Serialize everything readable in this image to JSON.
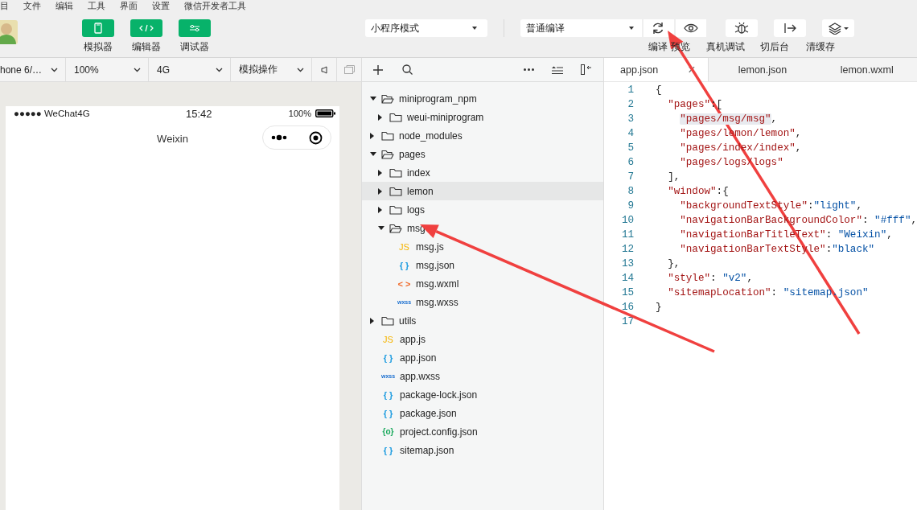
{
  "menu_bar": [
    "目",
    "文件",
    "编辑",
    "工具",
    "界面",
    "设置",
    "微信开发者工具"
  ],
  "toolbar": {
    "view_buttons": [
      {
        "label": "模拟器",
        "kind": "phone"
      },
      {
        "label": "编辑器",
        "kind": "code"
      },
      {
        "label": "调试器",
        "kind": "sliders"
      }
    ],
    "mode_select": "小程序模式",
    "compile_select": "普通编译",
    "actions": [
      {
        "label": "编译",
        "kind": "refresh"
      },
      {
        "label": "预览",
        "kind": "eye"
      },
      {
        "label": "真机调试",
        "kind": "bug"
      },
      {
        "label": "切后台",
        "kind": "switch"
      },
      {
        "label": "清缓存",
        "kind": "layers"
      }
    ]
  },
  "simulator": {
    "selects": [
      "hone 6/…",
      "100%",
      "4G",
      "模拟操作"
    ],
    "phone": {
      "carrier": "●●●●● WeChat4G",
      "time": "15:42",
      "battery": "100%",
      "title": "Weixin"
    }
  },
  "file_tree": [
    {
      "name": "miniprogram_npm",
      "kind": "folder",
      "expanded": true,
      "selected": false,
      "children": [
        {
          "name": "weui-miniprogram",
          "kind": "folder",
          "expanded": false,
          "selected": false
        }
      ]
    },
    {
      "name": "node_modules",
      "kind": "folder",
      "expanded": false,
      "selected": false
    },
    {
      "name": "pages",
      "kind": "folder",
      "expanded": true,
      "selected": false,
      "children": [
        {
          "name": "index",
          "kind": "folder",
          "expanded": false,
          "selected": false
        },
        {
          "name": "lemon",
          "kind": "folder",
          "expanded": false,
          "selected": true
        },
        {
          "name": "logs",
          "kind": "folder",
          "expanded": false,
          "selected": false
        },
        {
          "name": "msg",
          "kind": "folder",
          "expanded": true,
          "selected": false,
          "children": [
            {
              "name": "msg.js",
              "kind": "js",
              "badge": "JS",
              "selected": false
            },
            {
              "name": "msg.json",
              "kind": "json",
              "badge": "{ }",
              "selected": false
            },
            {
              "name": "msg.wxml",
              "kind": "wxml",
              "badge": "< >",
              "selected": false
            },
            {
              "name": "msg.wxss",
              "kind": "wxss",
              "badge": "wxss",
              "selected": false
            }
          ]
        }
      ]
    },
    {
      "name": "utils",
      "kind": "folder",
      "expanded": false,
      "selected": false
    },
    {
      "name": "app.js",
      "kind": "js",
      "badge": "JS",
      "selected": false
    },
    {
      "name": "app.json",
      "kind": "json",
      "badge": "{ }",
      "selected": false
    },
    {
      "name": "app.wxss",
      "kind": "wxss",
      "badge": "wxss",
      "selected": false
    },
    {
      "name": "package-lock.json",
      "kind": "json",
      "badge": "{ }",
      "selected": false
    },
    {
      "name": "package.json",
      "kind": "json",
      "badge": "{ }",
      "selected": false
    },
    {
      "name": "project.config.json",
      "kind": "config",
      "badge": "{o}",
      "selected": false
    },
    {
      "name": "sitemap.json",
      "kind": "json",
      "badge": "{ }",
      "selected": false
    }
  ],
  "editor": {
    "tabs": [
      {
        "label": "app.json",
        "selected": true,
        "close": "×"
      },
      {
        "label": "lemon.json",
        "selected": false
      },
      {
        "label": "lemon.wxml",
        "selected": false
      }
    ],
    "lines": [
      {
        "number": "1",
        "tokens": [
          {
            "kind": "punct",
            "text": "{"
          }
        ]
      },
      {
        "number": "2",
        "tokens": [
          {
            "kind": "key",
            "text": "  \"pages\""
          },
          {
            "kind": "punct",
            "text": ":["
          }
        ]
      },
      {
        "number": "3",
        "tokens": [
          {
            "kind": "key",
            "text": "    \"pages/msg/msg\"",
            "highlighted": true
          },
          {
            "kind": "punct",
            "text": ","
          }
        ]
      },
      {
        "number": "4",
        "tokens": [
          {
            "kind": "key",
            "text": "    \"pages/lemon/lemon\""
          },
          {
            "kind": "punct",
            "text": ","
          }
        ]
      },
      {
        "number": "5",
        "tokens": [
          {
            "kind": "key",
            "text": "    \"pages/index/index\""
          },
          {
            "kind": "punct",
            "text": ","
          }
        ]
      },
      {
        "number": "6",
        "tokens": [
          {
            "kind": "key",
            "text": "    \"pages/logs/logs\""
          }
        ]
      },
      {
        "number": "7",
        "tokens": [
          {
            "kind": "punct",
            "text": "  ],"
          }
        ]
      },
      {
        "number": "8",
        "tokens": [
          {
            "kind": "key",
            "text": "  \"window\""
          },
          {
            "kind": "punct",
            "text": ":{"
          }
        ]
      },
      {
        "number": "9",
        "tokens": [
          {
            "kind": "key",
            "text": "    \"backgroundTextStyle\""
          },
          {
            "kind": "punct",
            "text": ":"
          },
          {
            "kind": "value",
            "text": "\"light\""
          },
          {
            "kind": "punct",
            "text": ","
          }
        ]
      },
      {
        "number": "10",
        "tokens": [
          {
            "kind": "key",
            "text": "    \"navigationBarBackgroundColor\""
          },
          {
            "kind": "punct",
            "text": ": "
          },
          {
            "kind": "value",
            "text": "\"#fff\""
          },
          {
            "kind": "punct",
            "text": ","
          }
        ]
      },
      {
        "number": "11",
        "tokens": [
          {
            "kind": "key",
            "text": "    \"navigationBarTitleText\""
          },
          {
            "kind": "punct",
            "text": ": "
          },
          {
            "kind": "value",
            "text": "\"Weixin\""
          },
          {
            "kind": "punct",
            "text": ","
          }
        ]
      },
      {
        "number": "12",
        "tokens": [
          {
            "kind": "key",
            "text": "    \"navigationBarTextStyle\""
          },
          {
            "kind": "punct",
            "text": ":"
          },
          {
            "kind": "value",
            "text": "\"black\""
          }
        ]
      },
      {
        "number": "13",
        "tokens": [
          {
            "kind": "punct",
            "text": "  },"
          }
        ]
      },
      {
        "number": "14",
        "tokens": [
          {
            "kind": "key",
            "text": "  \"style\""
          },
          {
            "kind": "punct",
            "text": ": "
          },
          {
            "kind": "value",
            "text": "\"v2\""
          },
          {
            "kind": "punct",
            "text": ","
          }
        ]
      },
      {
        "number": "15",
        "tokens": [
          {
            "kind": "key",
            "text": "  \"sitemapLocation\""
          },
          {
            "kind": "punct",
            "text": ": "
          },
          {
            "kind": "value",
            "text": "\"sitemap.json\""
          }
        ]
      },
      {
        "number": "16",
        "tokens": [
          {
            "kind": "punct",
            "text": "}"
          }
        ]
      },
      {
        "number": "17"
      }
    ]
  },
  "annotations": [
    {
      "kind": "arrow"
    },
    {
      "kind": "arrow"
    }
  ]
}
